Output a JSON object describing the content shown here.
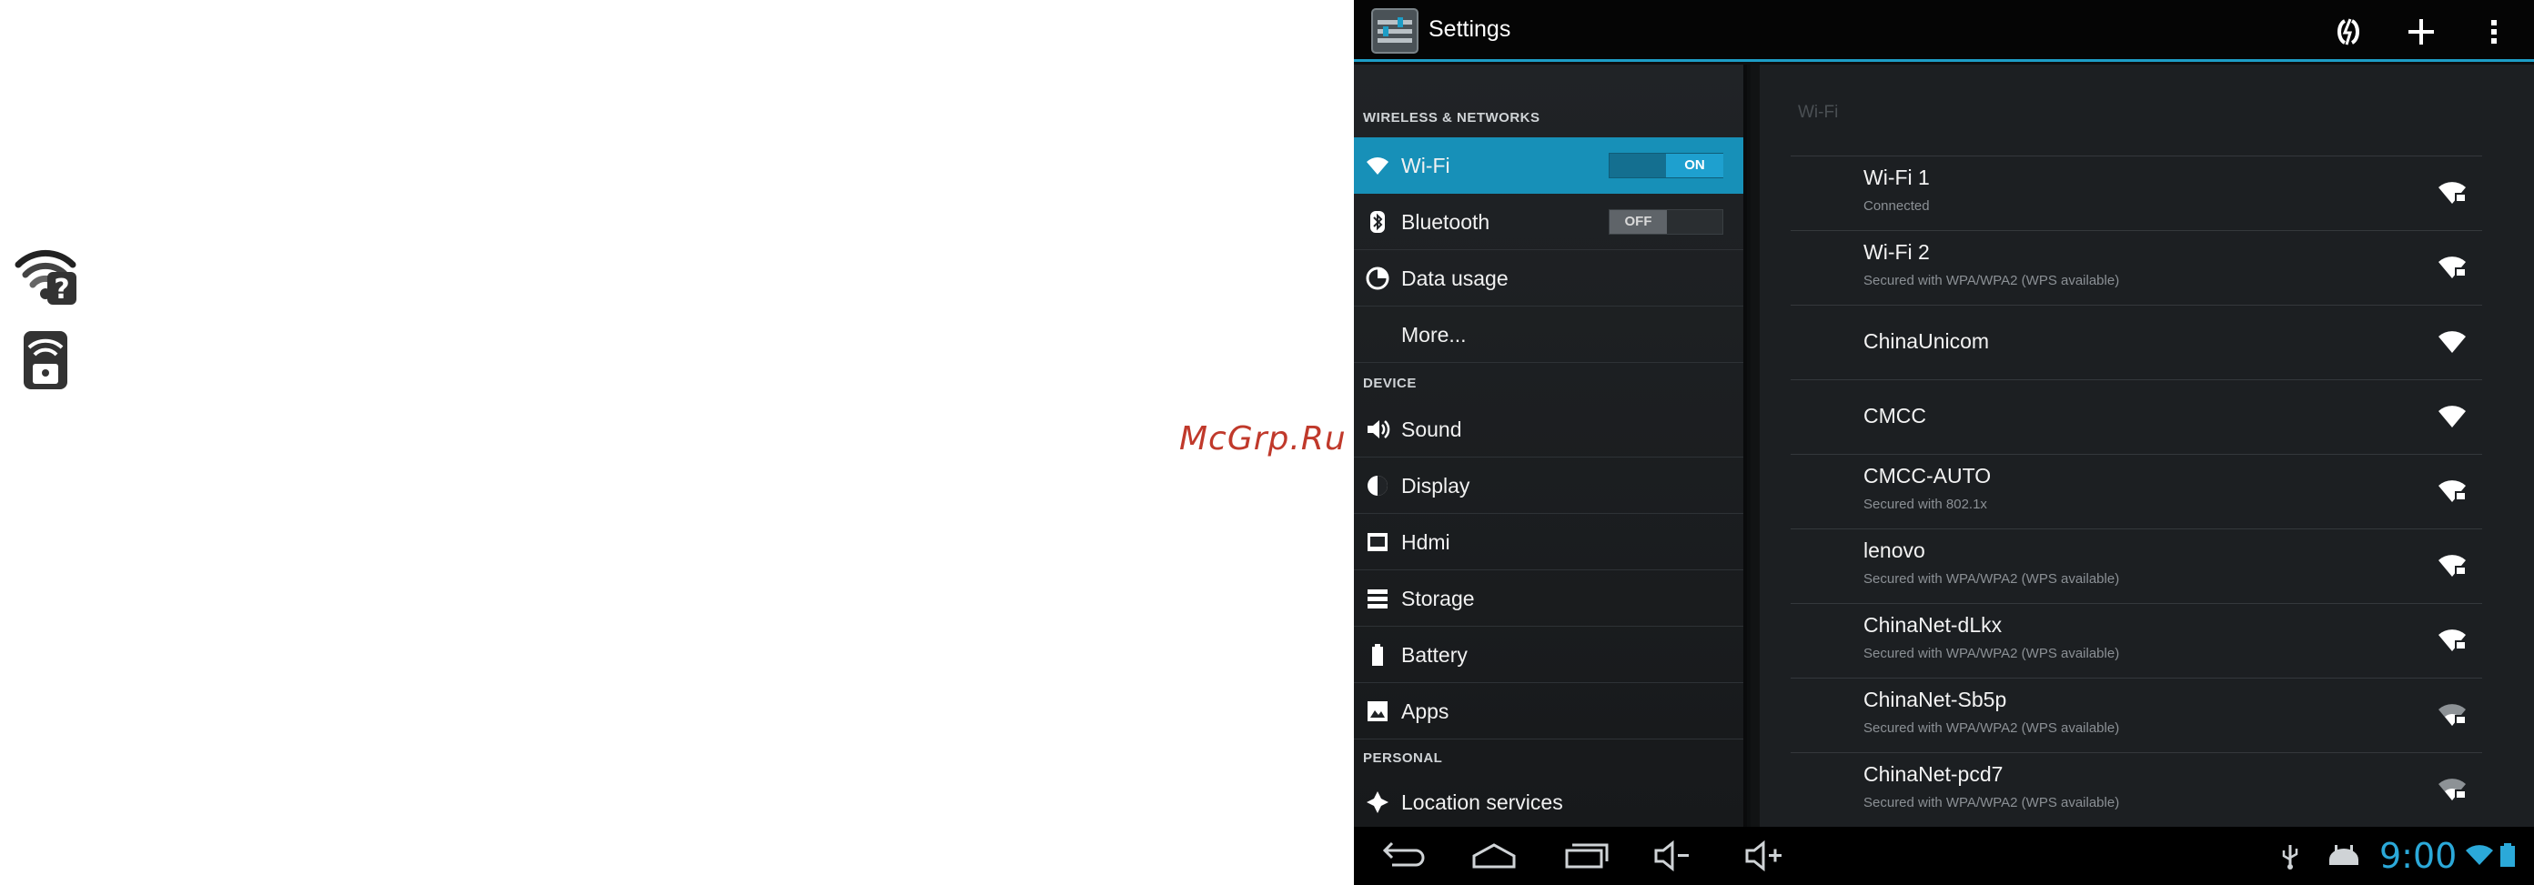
{
  "watermark": "McGrp.Ru",
  "app": {
    "title": "Settings"
  },
  "action_bar": {
    "icons": [
      "wps-icon",
      "add-icon",
      "overflow-menu-icon"
    ]
  },
  "sidebar": {
    "sections": [
      {
        "header": "WIRELESS & NETWORKS"
      },
      {
        "header": "DEVICE"
      },
      {
        "header": "PERSONAL"
      }
    ],
    "items": [
      {
        "label": "Wi-Fi",
        "icon": "wifi-icon",
        "selected": true,
        "toggle": "ON"
      },
      {
        "label": "Bluetooth",
        "icon": "bluetooth-icon",
        "toggle": "OFF"
      },
      {
        "label": "Data usage",
        "icon": "data-usage-icon"
      },
      {
        "label": "More..."
      },
      {
        "label": "Sound",
        "icon": "sound-icon"
      },
      {
        "label": "Display",
        "icon": "display-icon"
      },
      {
        "label": "Hdmi",
        "icon": "hdmi-icon"
      },
      {
        "label": "Storage",
        "icon": "storage-icon"
      },
      {
        "label": "Battery",
        "icon": "battery-icon"
      },
      {
        "label": "Apps",
        "icon": "apps-icon"
      },
      {
        "label": "Location services",
        "icon": "location-icon"
      }
    ]
  },
  "details": {
    "title": "Wi-Fi",
    "networks": [
      {
        "name": "Wi-Fi 1",
        "status": "Connected",
        "secured": true
      },
      {
        "name": "Wi-Fi 2",
        "status": "Secured with WPA/WPA2 (WPS available)",
        "secured": true
      },
      {
        "name": "ChinaUnicom",
        "status": "",
        "secured": false
      },
      {
        "name": "CMCC",
        "status": "",
        "secured": false
      },
      {
        "name": "CMCC-AUTO",
        "status": "Secured with 802.1x",
        "secured": true
      },
      {
        "name": "lenovo",
        "status": "Secured with WPA/WPA2 (WPS available)",
        "secured": true
      },
      {
        "name": "ChinaNet-dLkx",
        "status": "Secured with WPA/WPA2 (WPS available)",
        "secured": true
      },
      {
        "name": "ChinaNet-Sb5p",
        "status": "Secured with WPA/WPA2 (WPS available)",
        "secured": true
      },
      {
        "name": "ChinaNet-pcd7",
        "status": "Secured with WPA/WPA2 (WPS available)",
        "secured": true
      }
    ]
  },
  "system_bar": {
    "clock": "9:00",
    "nav": [
      "back-icon",
      "home-icon",
      "recent-apps-icon",
      "volume-down-icon",
      "volume-up-icon"
    ],
    "status_icons": [
      "usb-icon",
      "android-debug-icon",
      "wifi-signal-icon",
      "battery-status-icon"
    ]
  },
  "colors": {
    "accent": "#1d9dc6",
    "clock": "#2ba9d9",
    "watermark": "#c0392b"
  }
}
